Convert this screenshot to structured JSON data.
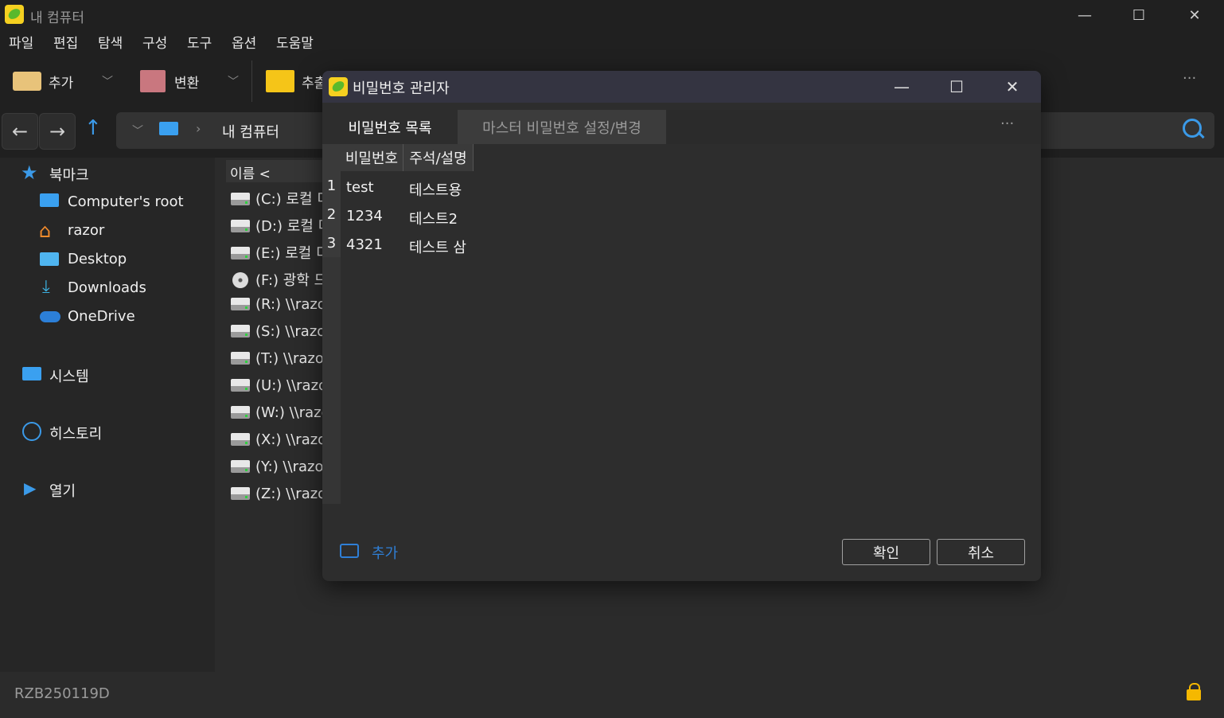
{
  "window": {
    "title": "내 컴퓨터",
    "minimize": "—",
    "maximize": "☐",
    "close": "✕"
  },
  "menu": [
    "파일",
    "편집",
    "탐색",
    "구성",
    "도구",
    "옵션",
    "도움말"
  ],
  "toolbar": {
    "add_label": "추가",
    "convert_label": "변환",
    "extract_label": "추출",
    "more": "···"
  },
  "address": {
    "location": "내 컴퓨터",
    "separator": "›"
  },
  "sidebar": {
    "bookmarks": "북마크",
    "items": [
      "Computer's root",
      "razor",
      "Desktop",
      "Downloads",
      "OneDrive"
    ],
    "system": "시스템",
    "history": "히스토리",
    "open": "열기"
  },
  "filelist": {
    "column_name": "이름 <",
    "drives": [
      "(C:) 로컬 디스크",
      "(D:) 로컬 디스크",
      "(E:) 로컬 디스크",
      "(F:) 광학 드라이브",
      "(R:) \\\\razor",
      "(S:) \\\\razor",
      "(T:) \\\\razor",
      "(U:) \\\\razor",
      "(W:) \\\\razor",
      "(X:) \\\\razor",
      "(Y:) \\\\razor",
      "(Z:) \\\\razor"
    ]
  },
  "status": {
    "text": "RZB250119D"
  },
  "dialog": {
    "title": "비밀번호 관리자",
    "tabs": [
      "비밀번호 목록",
      "마스터 비밀번호 설정/변경"
    ],
    "more": "···",
    "columns": [
      "비밀번호",
      "주석/설명"
    ],
    "rows": [
      {
        "n": "1",
        "password": "test",
        "note": "테스트용"
      },
      {
        "n": "2",
        "password": "1234",
        "note": "테스트2"
      },
      {
        "n": "3",
        "password": "4321",
        "note": "테스트 삼"
      }
    ],
    "add_label": "추가",
    "ok": "확인",
    "cancel": "취소"
  },
  "colors": {
    "accent": "#2f7fd6",
    "folder": "#f5c518",
    "dialog_title_bg": "#343441"
  }
}
